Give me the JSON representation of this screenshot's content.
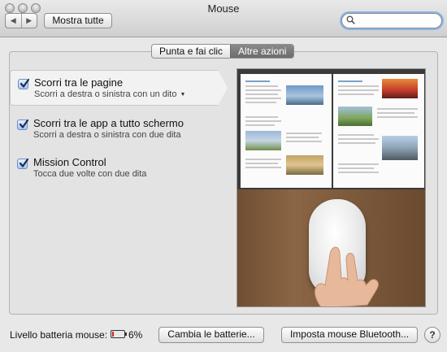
{
  "window": {
    "title": "Mouse",
    "show_all_label": "Mostra tutte",
    "nav_back": "◀",
    "nav_forward": "▶",
    "search": {
      "value": "",
      "placeholder": ""
    }
  },
  "tabs": [
    {
      "label": "Punta e fai clic",
      "active": false
    },
    {
      "label": "Altre azioni",
      "active": true
    }
  ],
  "options": [
    {
      "title": "Scorri tra le pagine",
      "subtitle": "Scorri a destra o sinistra con un dito",
      "checked": true,
      "has_dropdown": true,
      "selected": true
    },
    {
      "title": "Scorri tra le app a tutto schermo",
      "subtitle": "Scorri a destra o sinistra con due dita",
      "checked": true,
      "has_dropdown": false,
      "selected": false
    },
    {
      "title": "Mission Control",
      "subtitle": "Tocca due volte con due dita",
      "checked": true,
      "has_dropdown": false,
      "selected": false
    }
  ],
  "footer": {
    "battery_label": "Livello batteria mouse:",
    "battery_percent": "6%",
    "battery_level": 0.06,
    "change_batteries_label": "Cambia le batterie...",
    "bluetooth_label": "Imposta mouse Bluetooth...",
    "help_label": "?"
  },
  "colors": {
    "battery_low": "#d91a1a",
    "checkbox": "#a9c6f0",
    "active_tab": "#6c6c6c"
  },
  "icons": {
    "search": "magnifier-icon",
    "checkbox": "checkmark-icon",
    "dropdown": "triangle-down-icon",
    "battery": "battery-low-icon"
  }
}
